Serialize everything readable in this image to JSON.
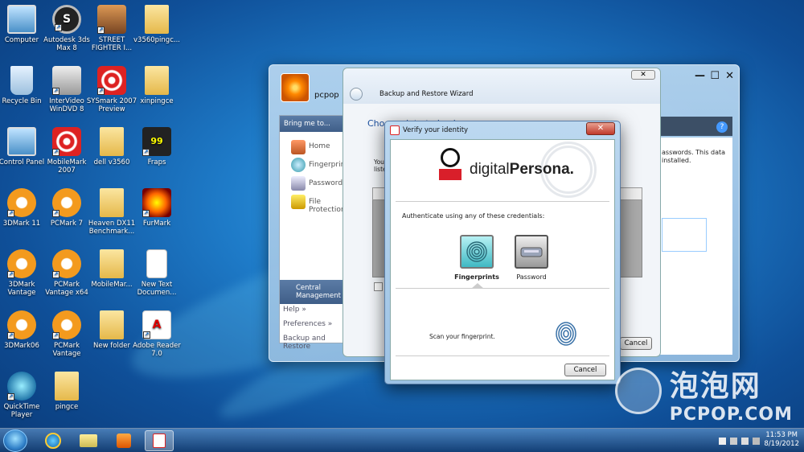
{
  "desktop": {
    "icons": [
      {
        "label": "Computer",
        "icon": "computer-icon"
      },
      {
        "label": "Autodesk 3ds Max 8",
        "icon": "autodesk-3ds-icon"
      },
      {
        "label": "STREET FIGHTER I...",
        "icon": "street-fighter-icon"
      },
      {
        "label": "v3560pingc...",
        "icon": "folder-icon"
      },
      {
        "label": "Recycle Bin",
        "icon": "recycle-bin-icon"
      },
      {
        "label": "InterVideo WinDVD 8",
        "icon": "windvd-icon"
      },
      {
        "label": "SYSmark 2007 Preview",
        "icon": "sysmark-icon"
      },
      {
        "label": "xinpingce",
        "icon": "folder-icon"
      },
      {
        "label": "Control Panel",
        "icon": "control-panel-icon"
      },
      {
        "label": "MobileMark 2007",
        "icon": "mobilemark-icon"
      },
      {
        "label": "dell v3560",
        "icon": "folder-icon"
      },
      {
        "label": "Fraps",
        "icon": "fraps-icon"
      },
      {
        "label": "3DMark 11",
        "icon": "3dmark-icon"
      },
      {
        "label": "PCMark 7",
        "icon": "pcmark-icon"
      },
      {
        "label": "Heaven DX11 Benchmark...",
        "icon": "folder-icon"
      },
      {
        "label": "FurMark",
        "icon": "furmark-icon"
      },
      {
        "label": "3DMark Vantage",
        "icon": "3dmark-icon"
      },
      {
        "label": "PCMark Vantage x64",
        "icon": "pcmark-icon"
      },
      {
        "label": "MobileMar...",
        "icon": "folder-icon"
      },
      {
        "label": "New Text Documen...",
        "icon": "text-document-icon"
      },
      {
        "label": "3DMark06",
        "icon": "3dmark-icon"
      },
      {
        "label": "PCMark Vantage",
        "icon": "pcmark-icon"
      },
      {
        "label": "New folder",
        "icon": "folder-icon"
      },
      {
        "label": "Adobe Reader 7.0",
        "icon": "adobe-reader-icon"
      },
      {
        "label": "QuickTime Player",
        "icon": "quicktime-icon"
      },
      {
        "label": "pingce",
        "icon": "folder-icon"
      }
    ]
  },
  "bg_window": {
    "user": "pcpop",
    "nav_header": "Bring me to...",
    "nav_items": [
      "Home",
      "Fingerprints",
      "Passwords",
      "File Protection"
    ],
    "central": "Central Management",
    "footer": [
      "Help »",
      "Preferences »",
      "Backup and Restore"
    ],
    "right_text": "asswords. This data installed.",
    "help_icon": "?"
  },
  "wizard": {
    "title": "Backup and Restore Wizard",
    "subtitle": "Choose data to back up",
    "partial_text": "You liste",
    "cancel": "Cancel"
  },
  "verify": {
    "title": "Verify your identity",
    "brand_light": "digital",
    "brand_bold": "Persona.",
    "instruction": "Authenticate using any of these credentials:",
    "cred_fingerprints": "Fingerprints",
    "cred_password": "Password",
    "scan_text": "Scan your fingerprint.",
    "cancel": "Cancel"
  },
  "watermark": {
    "cn": "泡泡网",
    "en": "PCPOP.COM"
  },
  "taskbar": {
    "time": "11:53 PM",
    "date": "8/19/2012"
  },
  "colors": {
    "dp_red": "#d91f2a",
    "accent_blue": "#1a4f9e"
  }
}
